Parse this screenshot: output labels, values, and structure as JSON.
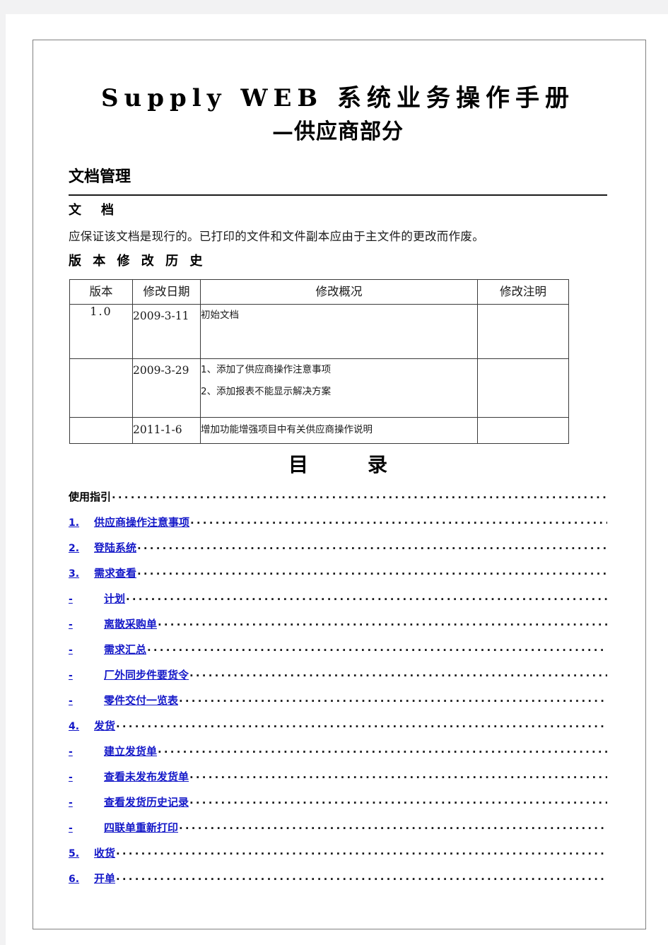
{
  "document": {
    "title": "Supply  WEB 系统业务操作手册",
    "subtitle": "—供应商部分",
    "section_heading": "文档管理",
    "sub_heading": "文　档",
    "notice": "应保证该文档是现行的。已打印的文件和文件副本应由于主文件的更改而作废。",
    "history_heading": "版 本 修 改 历 史"
  },
  "history_table": {
    "headers": [
      "版本",
      "修改日期",
      "修改概况",
      "修改注明"
    ],
    "rows": [
      {
        "version": "1.0",
        "date": "2009-3-11",
        "desc": [
          "初始文档"
        ],
        "note": ""
      },
      {
        "version": "",
        "date": "2009-3-29",
        "desc": [
          "1、添加了供应商操作注意事项",
          "2、添加报表不能显示解决方案"
        ],
        "note": ""
      },
      {
        "version": "",
        "date": "2011-1-6",
        "desc": [
          "增加功能增强项目中有关供应商操作说明"
        ],
        "note": ""
      }
    ]
  },
  "toc": {
    "title": "目　录",
    "dots": "...................................................................................",
    "entries": [
      {
        "level": 0,
        "num": "",
        "label": "使用指引"
      },
      {
        "level": 1,
        "num": "1.",
        "label": "供应商操作注意事项"
      },
      {
        "level": 1,
        "num": "2.",
        "label": "登陆系统"
      },
      {
        "level": 1,
        "num": "3.",
        "label": "需求查看"
      },
      {
        "level": 2,
        "num": "-",
        "label": "计划"
      },
      {
        "level": 2,
        "num": "-",
        "label": "离散采购单"
      },
      {
        "level": 2,
        "num": "-",
        "label": "需求汇总"
      },
      {
        "level": 2,
        "num": "-",
        "label": "厂外同步件要货令"
      },
      {
        "level": 2,
        "num": "-",
        "label": "零件交付一览表"
      },
      {
        "level": 1,
        "num": "4.",
        "label": "发货"
      },
      {
        "level": 2,
        "num": "-",
        "label": "建立发货单"
      },
      {
        "level": 2,
        "num": "-",
        "label": "查看未发布发货单"
      },
      {
        "level": 2,
        "num": "-",
        "label": "查看发货历史记录"
      },
      {
        "level": 2,
        "num": "-",
        "label": "四联单重新打印"
      },
      {
        "level": 1,
        "num": "5.",
        "label": "收货"
      },
      {
        "level": 1,
        "num": "6.",
        "label": "开单"
      }
    ]
  },
  "colors": {
    "link": "#1418c8",
    "text": "#1a1a1a",
    "frame": "#808080",
    "page_background": "#f2f2f3"
  }
}
